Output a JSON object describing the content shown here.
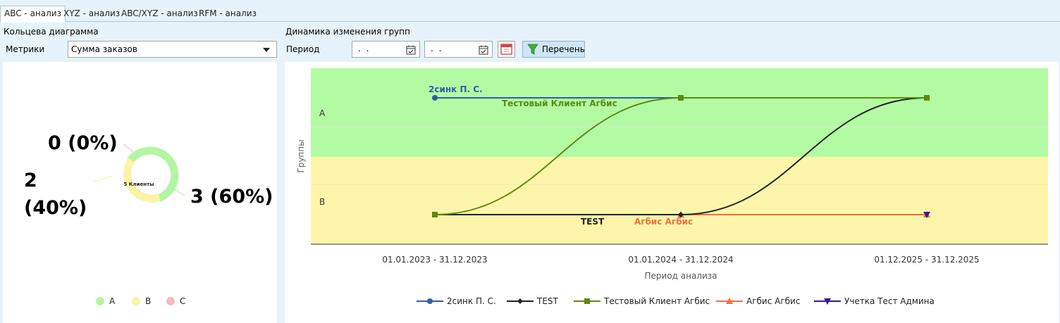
{
  "tabs": [
    {
      "label": "ABC - анализ",
      "active": true
    },
    {
      "label": "XYZ - анализ",
      "active": false
    },
    {
      "label": "ABC/XYZ - анализ",
      "active": false
    },
    {
      "label": "RFM - анализ",
      "active": false
    }
  ],
  "left": {
    "title": "Кольцева диаграмма",
    "metric_label": "Метрики",
    "metric_value": "Сумма заказов",
    "donut_center": "5 Клиенты",
    "labels": {
      "a": "3 (60%)",
      "b_line1": "2",
      "b_line2": "(40%)",
      "c": "0 (0%)"
    },
    "legend": [
      {
        "label": "A",
        "color": "#b3f5a3"
      },
      {
        "label": "B",
        "color": "#fbf3a6"
      },
      {
        "label": "C",
        "color": "#f9b8c3"
      }
    ]
  },
  "right": {
    "title": "Динамика изменения групп",
    "period_label": "Период",
    "date_from": ". .",
    "date_to": ". .",
    "list_button": "Перечень"
  },
  "chart_data": [
    {
      "type": "pie",
      "title": "",
      "center_label": "5 Клиенты",
      "categories": [
        "A",
        "B",
        "C"
      ],
      "values": [
        3,
        2,
        0
      ],
      "percent": [
        60,
        40,
        0
      ],
      "colors": [
        "#b3f5a3",
        "#fbf3a6",
        "#f9b8c3"
      ],
      "legend_position": "bottom"
    },
    {
      "type": "line",
      "xlabel": "Период анализа",
      "ylabel": "Группы",
      "categories": [
        "01.01.2023 - 31.12.2023",
        "01.01.2024 - 31.12.2024",
        "01.12.2025 - 31.12.2025"
      ],
      "y_categories": [
        "A",
        "B"
      ],
      "bands": [
        {
          "group": "A",
          "color": "#b3fba3"
        },
        {
          "group": "B",
          "color": "#fdf6aa"
        }
      ],
      "legend_position": "bottom",
      "series": [
        {
          "name": "2синк П. С.",
          "color": "#2e5fa8",
          "marker": "circle",
          "points": [
            [
              "01.01.2023 - 31.12.2023",
              "A"
            ],
            [
              "01.01.2024 - 31.12.2024",
              "A"
            ]
          ]
        },
        {
          "name": "TEST",
          "color": "#222222",
          "marker": "diamond",
          "points": [
            [
              "01.01.2023 - 31.12.2023",
              "B"
            ],
            [
              "01.01.2024 - 31.12.2024",
              "B"
            ],
            [
              "01.12.2025 - 31.12.2025",
              "A"
            ]
          ]
        },
        {
          "name": "Тестовый Клиент Агбис",
          "color": "#5d8a0f",
          "marker": "square",
          "points": [
            [
              "01.01.2023 - 31.12.2023",
              "B"
            ],
            [
              "01.01.2024 - 31.12.2024",
              "A"
            ],
            [
              "01.12.2025 - 31.12.2025",
              "A"
            ]
          ]
        },
        {
          "name": "Агбис Агбис",
          "color": "#f07040",
          "marker": "triangle",
          "points": [
            [
              "01.01.2024 - 31.12.2024",
              "B"
            ],
            [
              "01.12.2025 - 31.12.2025",
              "B"
            ]
          ]
        },
        {
          "name": "Учетка Тест Админа",
          "color": "#3d1a8c",
          "marker": "triangle-down",
          "points": [
            [
              "01.12.2025 - 31.12.2025",
              "B"
            ]
          ]
        }
      ]
    }
  ]
}
